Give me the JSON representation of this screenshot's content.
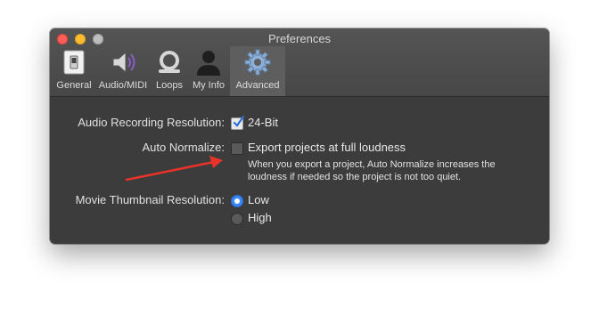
{
  "window": {
    "title": "Preferences"
  },
  "toolbar": {
    "items": [
      {
        "label": "General",
        "icon": "switch-icon"
      },
      {
        "label": "Audio/MIDI",
        "icon": "speaker-icon"
      },
      {
        "label": "Loops",
        "icon": "loop-icon"
      },
      {
        "label": "My Info",
        "icon": "person-icon"
      },
      {
        "label": "Advanced",
        "icon": "gear-icon",
        "selected": true
      }
    ]
  },
  "settings": {
    "audio_recording": {
      "label": "Audio Recording Resolution:",
      "option": "24-Bit",
      "checked": true
    },
    "auto_normalize": {
      "label": "Auto Normalize:",
      "option": "Export projects at full loudness",
      "checked": false,
      "help": "When you export a project, Auto Normalize increases the loudness if needed so the project is not too quiet."
    },
    "movie_thumbnail": {
      "label": "Movie Thumbnail Resolution:",
      "options": [
        {
          "label": "Low",
          "selected": true
        },
        {
          "label": "High",
          "selected": false
        }
      ]
    }
  },
  "colors": {
    "arrow": "#e8332a",
    "accent": "#3a87f5"
  }
}
